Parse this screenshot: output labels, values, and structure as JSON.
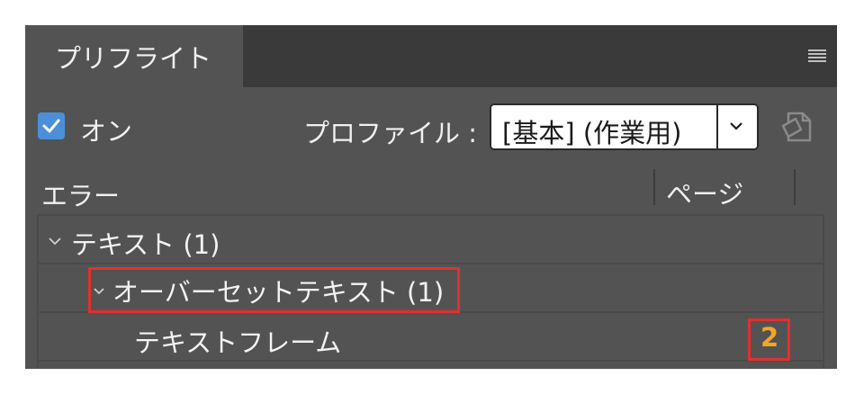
{
  "panel": {
    "tab_title": "プリフライト",
    "on_label": "オン",
    "on_checked": true,
    "profile_label": "プロファイル :",
    "profile_value": "[基本] (作業用)",
    "columns": {
      "error": "エラー",
      "page": "ページ"
    },
    "rows": [
      {
        "label": "テキスト (1)",
        "expanded": true
      },
      {
        "label": "オーバーセットテキスト (1)",
        "expanded": true
      },
      {
        "label": "テキストフレーム",
        "page": "2"
      }
    ],
    "colors": {
      "panel_bg": "#535353",
      "tabbar_bg": "#3a3a3a",
      "checkbox": "#4a8fd8",
      "page_link": "#f5a623",
      "highlight": "#e23030"
    }
  }
}
